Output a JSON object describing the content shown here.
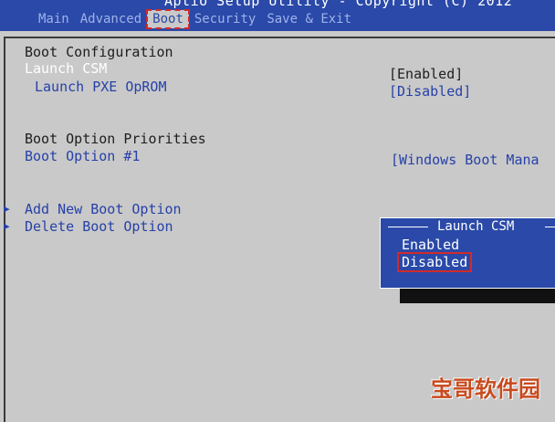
{
  "header": {
    "title": "Aptio Setup Utility - Copyright (C) 2012",
    "tabs": [
      {
        "label": "Main",
        "active": false
      },
      {
        "label": "Advanced",
        "active": false
      },
      {
        "label": "Boot",
        "active": true
      },
      {
        "label": "Security",
        "active": false
      },
      {
        "label": "Save & Exit",
        "active": false
      }
    ]
  },
  "boot_config": {
    "heading": "Boot Configuration",
    "launch_csm_label": "Launch CSM",
    "launch_csm_value": "[Enabled]",
    "pxe_label": "Launch PXE OpROM",
    "pxe_value": "[Disabled]"
  },
  "boot_priorities": {
    "heading": "Boot Option Priorities",
    "option1_label": "Boot Option #1",
    "option1_value": "[Windows Boot Mana"
  },
  "actions": {
    "add_label": "Add New Boot Option",
    "delete_label": "Delete Boot Option"
  },
  "popup": {
    "title": "Launch CSM",
    "options": [
      "Enabled",
      "Disabled"
    ],
    "selected": "Disabled"
  },
  "watermark": "宝哥软件园",
  "colors": {
    "header_blue": "#2a49a8",
    "background_gray": "#c9c9c9",
    "highlight_red": "#d22a2a",
    "item_blue": "#2741a8"
  }
}
